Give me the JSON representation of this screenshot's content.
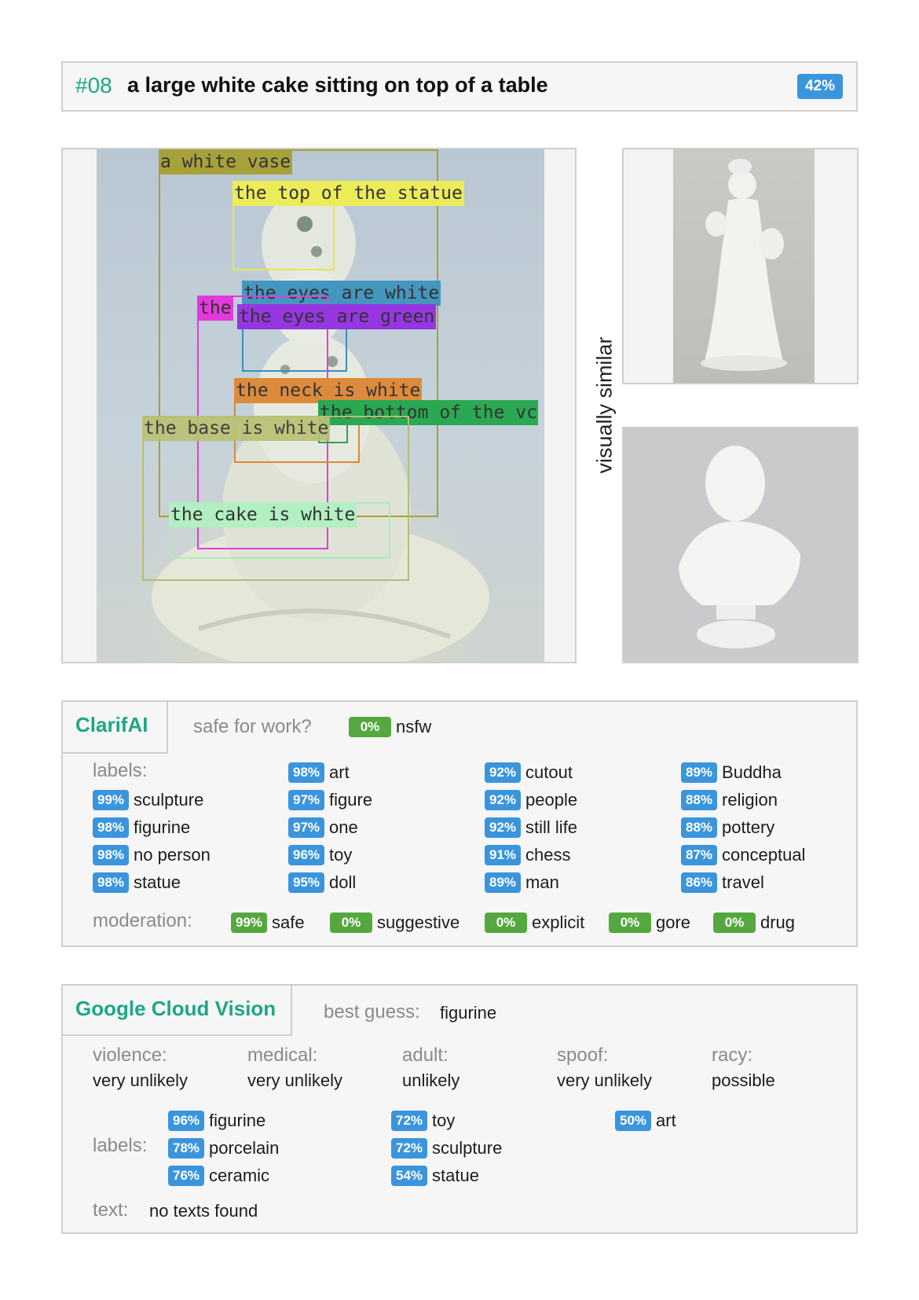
{
  "header": {
    "index": "#08",
    "caption": "a large white cake sitting on top of a table",
    "score": "42%"
  },
  "image_labels": {
    "white_vase": "a white vase",
    "top_statue": "the top of the statue",
    "eyes_white": "the eyes are white",
    "the": "the",
    "eyes_green": "the eyes are green",
    "neck_white": "the neck is white",
    "bottom_vc": "the bottom of the vc",
    "base_white": "the base is white",
    "cake_white": "the cake is white"
  },
  "visually_similar": "visually similar",
  "clarifai": {
    "title": "ClarifAI",
    "sfw_label": "safe for work?",
    "nsfw_pct": "0%",
    "nsfw_text": "nsfw",
    "labels_title": "labels:",
    "labels": [
      {
        "pct": "99%",
        "name": "sculpture"
      },
      {
        "pct": "98%",
        "name": "figurine"
      },
      {
        "pct": "98%",
        "name": "no person"
      },
      {
        "pct": "98%",
        "name": "statue"
      },
      {
        "pct": "98%",
        "name": "art"
      },
      {
        "pct": "97%",
        "name": "figure"
      },
      {
        "pct": "97%",
        "name": "one"
      },
      {
        "pct": "96%",
        "name": "toy"
      },
      {
        "pct": "95%",
        "name": "doll"
      },
      {
        "pct": "92%",
        "name": "cutout"
      },
      {
        "pct": "92%",
        "name": "people"
      },
      {
        "pct": "92%",
        "name": "still life"
      },
      {
        "pct": "91%",
        "name": "chess"
      },
      {
        "pct": "89%",
        "name": "man"
      },
      {
        "pct": "89%",
        "name": "Buddha"
      },
      {
        "pct": "88%",
        "name": "religion"
      },
      {
        "pct": "88%",
        "name": "pottery"
      },
      {
        "pct": "87%",
        "name": "conceptual"
      },
      {
        "pct": "86%",
        "name": "travel"
      }
    ],
    "moderation_title": "moderation:",
    "moderation": [
      {
        "pct": "99%",
        "name": "safe"
      },
      {
        "pct": "0%",
        "name": "suggestive"
      },
      {
        "pct": "0%",
        "name": "explicit"
      },
      {
        "pct": "0%",
        "name": "gore"
      },
      {
        "pct": "0%",
        "name": "drug"
      }
    ]
  },
  "gcv": {
    "title": "Google Cloud Vision",
    "best_guess_label": "best guess:",
    "best_guess_value": "figurine",
    "safe": [
      {
        "name": "violence:",
        "value": "very unlikely"
      },
      {
        "name": "medical:",
        "value": "very unlikely"
      },
      {
        "name": "adult:",
        "value": "unlikely"
      },
      {
        "name": "spoof:",
        "value": "very unlikely"
      },
      {
        "name": "racy:",
        "value": "possible"
      }
    ],
    "labels_title": "labels:",
    "labels": [
      {
        "pct": "96%",
        "name": "figurine"
      },
      {
        "pct": "78%",
        "name": "porcelain"
      },
      {
        "pct": "76%",
        "name": "ceramic"
      },
      {
        "pct": "72%",
        "name": "toy"
      },
      {
        "pct": "72%",
        "name": "sculpture"
      },
      {
        "pct": "54%",
        "name": "statue"
      },
      {
        "pct": "50%",
        "name": "art"
      }
    ],
    "text_label": "text:",
    "text_value": "no texts found"
  },
  "colors": {
    "accent_green": "#1ea784",
    "badge_blue": "#3a95dd",
    "badge_green": "#55a83f"
  }
}
